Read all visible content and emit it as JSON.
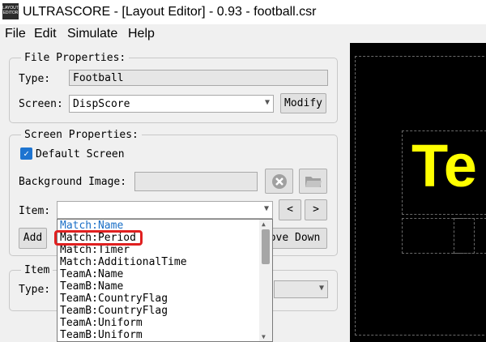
{
  "window": {
    "title": "ULTRASCORE - [Layout Editor] - 0.93 - football.csr",
    "icon_label": "LAYOUT EDITOR"
  },
  "menu": [
    "File",
    "Edit",
    "Simulate",
    "Help"
  ],
  "file_properties": {
    "legend": "File Properties:",
    "type_label": "Type:",
    "type_value": "Football",
    "screen_label": "Screen:",
    "screen_value": "DispScore",
    "modify_label": "Modify"
  },
  "screen_properties": {
    "legend": "Screen Properties:",
    "default_label": "Default Screen",
    "default_checked": true,
    "bg_label": "Background Image:",
    "item_label": "Item:",
    "item_value": "",
    "add_label": "Add",
    "move_down_label": "ove Down"
  },
  "item_properties": {
    "legend": "Item",
    "type_label": "Type:"
  },
  "dropdown": {
    "selected_index": 0,
    "options": [
      "Match:Name",
      "Match:Period",
      "Match:Timer",
      "Match:AdditionalTime",
      "TeamA:Name",
      "TeamB:Name",
      "TeamA:CountryFlag",
      "TeamB:CountryFlag",
      "TeamA:Uniform",
      "TeamB:Uniform"
    ]
  },
  "preview": {
    "text": "Te",
    "text_color": "#ffff00",
    "background": "#000000"
  },
  "colors": {
    "accent": "#1e74d0",
    "highlight": "#e02020",
    "selected_option": "#1a6fc7"
  }
}
